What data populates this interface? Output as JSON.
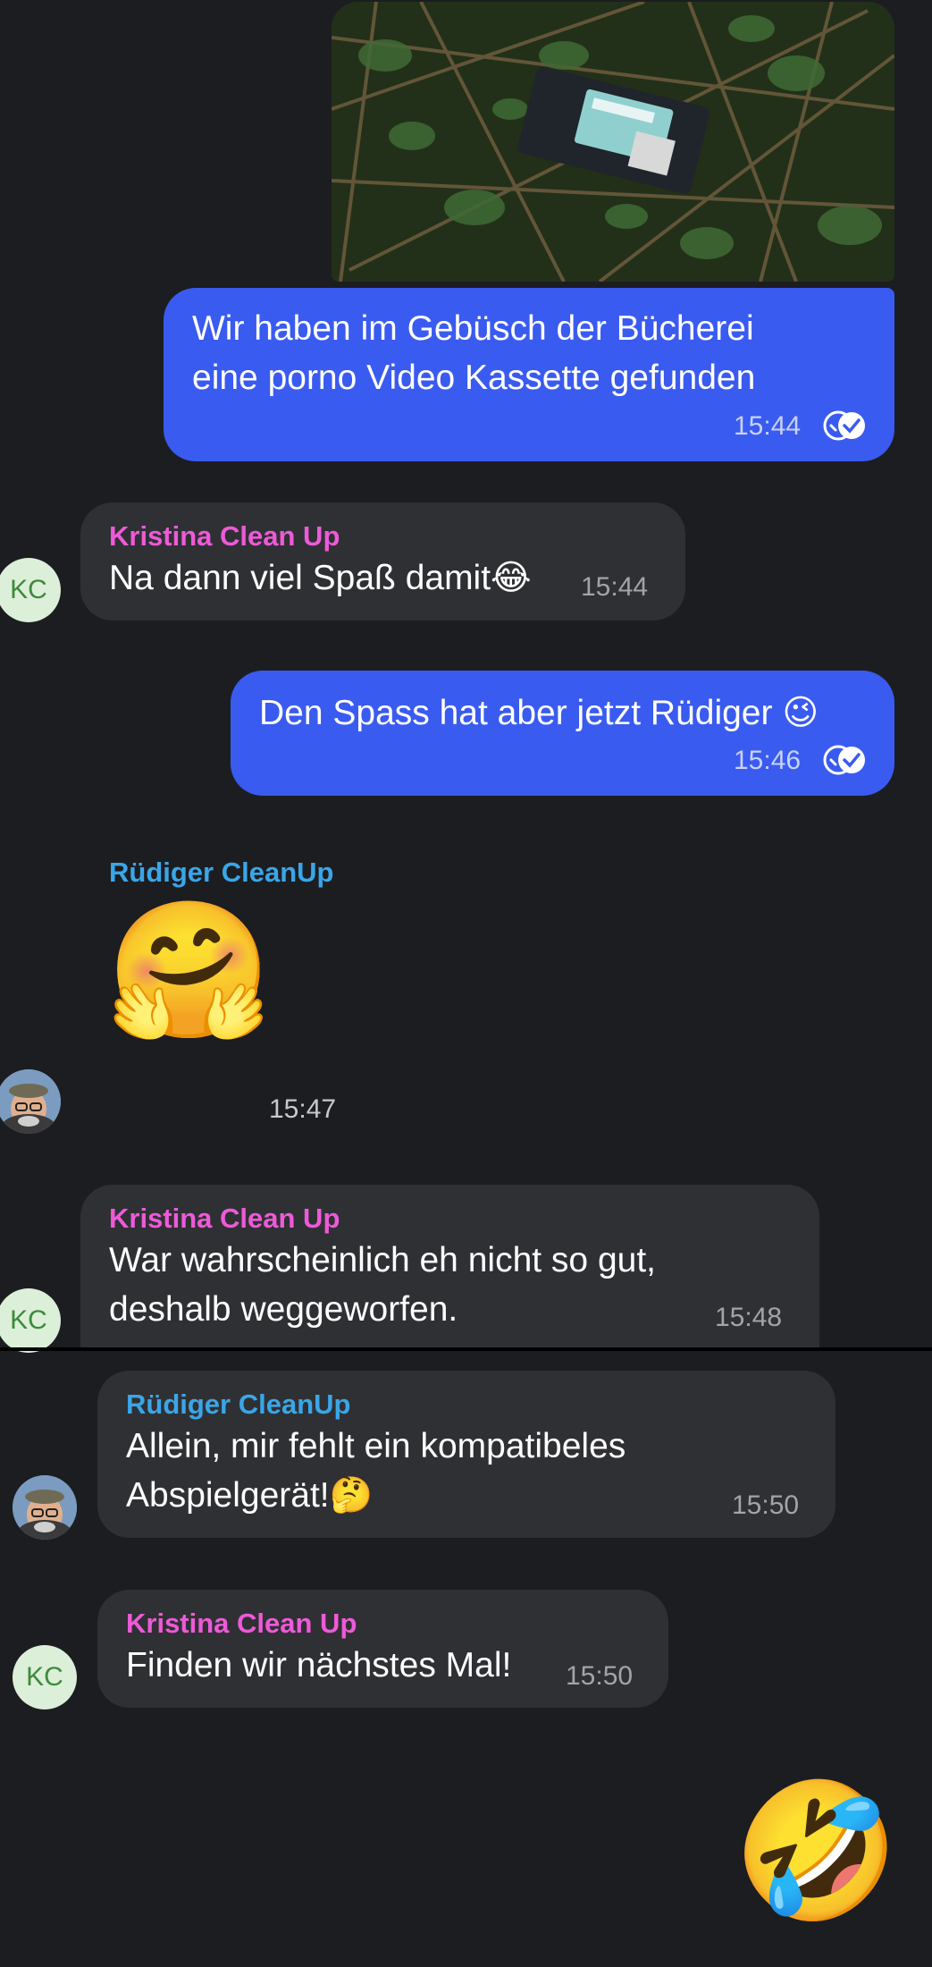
{
  "messages": [
    {
      "kind": "photo",
      "alt": ""
    },
    {
      "kind": "outgoing",
      "text_line1": "Wir haben im Gebüsch der Bücherei",
      "text_line2": "eine porno Video Kassette gefunden",
      "time": "15:44"
    },
    {
      "kind": "incoming",
      "sender": "Kristina Clean Up",
      "text": "Na dann viel Spaß damit😂",
      "time": "15:44",
      "avatar": "KC"
    },
    {
      "kind": "outgoing",
      "text": "Den Spass hat aber jetzt Rüdiger 😉",
      "time": "15:46"
    },
    {
      "kind": "incoming-sticker",
      "sender": "Rüdiger CleanUp",
      "emoji": "🤗",
      "time": "15:47"
    },
    {
      "kind": "incoming",
      "sender": "Kristina Clean Up",
      "text_line1": "War wahrscheinlich eh nicht so gut,",
      "text_line2": "deshalb weggeworfen.",
      "time": "15:48",
      "avatar": "KC"
    },
    {
      "kind": "incoming",
      "sender": "Rüdiger CleanUp",
      "text_line1": "Allein, mir fehlt ein kompatibeles",
      "text_line2": "Abspielgerät!🤔",
      "time": "15:50"
    },
    {
      "kind": "incoming",
      "sender": "Kristina Clean Up",
      "text": "Finden wir nächstes Mal!",
      "time": "15:50",
      "avatar": "KC"
    },
    {
      "kind": "outgoing-sticker",
      "emoji": "🤣"
    }
  ],
  "colors": {
    "background": "#1c1d21",
    "outgoing_bubble": "#3a5bf0",
    "incoming_bubble": "#2f3034",
    "kristina_name": "#ee5ad8",
    "ruediger_name": "#3aa6e8",
    "avatar_bg": "#dcefd9",
    "avatar_text": "#3d8a3c"
  }
}
